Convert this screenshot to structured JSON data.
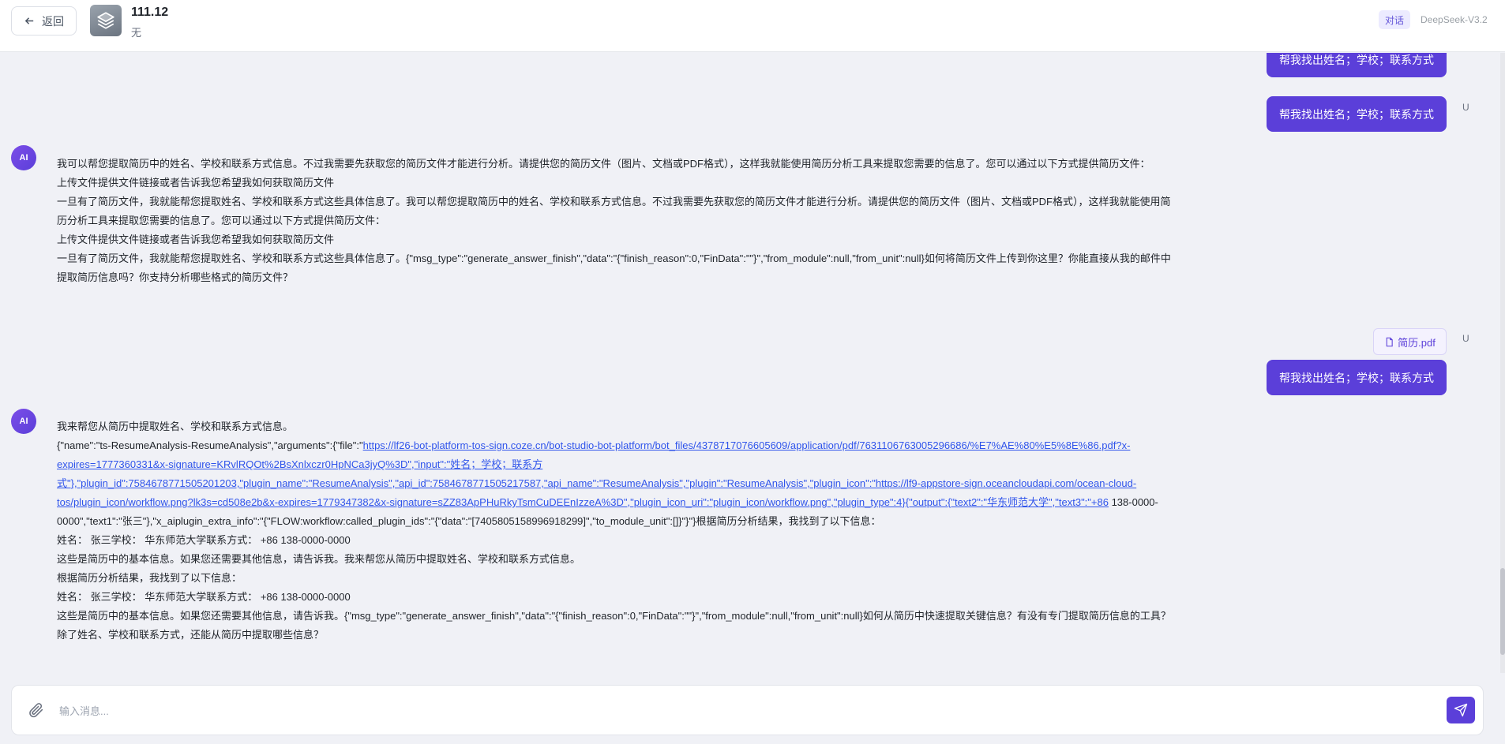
{
  "header": {
    "back_label": "返回",
    "app_title": "111.12",
    "app_subtitle": "无",
    "mode_label": "对话",
    "model_name": "DeepSeek-V3.2",
    "app_icon": "stack-layers-icon"
  },
  "messages": {
    "user_1": "帮我找出姓名；学校；联系方式",
    "user_2": "帮我找出姓名；学校；联系方式",
    "user_2_avatar": "U",
    "ai_1_avatar": "AI",
    "ai_1_lines": [
      "我可以帮您提取简历中的姓名、学校和联系方式信息。不过我需要先获取您的简历文件才能进行分析。请提供您的简历文件（图片、文档或PDF格式），这样我就能使用简历分析工具来提取您需要的信息了。您可以通过以下方式提供简历文件：",
      "上传文件提供文件链接或者告诉我您希望我如何获取简历文件",
      "一旦有了简历文件，我就能帮您提取姓名、学校和联系方式这些具体信息了。我可以帮您提取简历中的姓名、学校和联系方式信息。不过我需要先获取您的简历文件才能进行分析。请提供您的简历文件（图片、文档或PDF格式），这样我就能使用简历分析工具来提取您需要的信息了。您可以通过以下方式提供简历文件：",
      "上传文件提供文件链接或者告诉我您希望我如何获取简历文件",
      "一旦有了简历文件，我就能帮您提取姓名、学校和联系方式这些具体信息了。{\"msg_type\":\"generate_answer_finish\",\"data\":\"{\"finish_reason\":0,\"FinData\":\"\"}\",\"from_module\":null,\"from_unit\":null}如何将简历文件上传到你这里？你能直接从我的邮件中提取简历信息吗？你支持分析哪些格式的简历文件？"
    ],
    "file_name": "简历.pdf",
    "user_3_avatar": "U",
    "user_3": "帮我找出姓名；学校；联系方式",
    "ai_2_avatar": "AI",
    "ai_2_intro": "我来帮您从简历中提取姓名、学校和联系方式信息。",
    "ai_2_json_prefix": "{\"name\":\"ts-ResumeAnalysis-ResumeAnalysis\",\"arguments\":{\"file\":\"",
    "ai_2_link": "https://lf26-bot-platform-tos-sign.coze.cn/bot-studio-bot-platform/bot_files/4378717076605609/application/pdf/7631106763005296686/%E7%AE%80%E5%8E%86.pdf?x-expires=1777360331&x-signature=KRvlRQOt%2BsXnlxczr0HpNCa3jyQ%3D\",\"input\":\"姓名；学校；联系方式\"},\"plugin_id\":7584678771505201203,\"plugin_name\":\"ResumeAnalysis\",\"api_id\":7584678771505217587,\"api_name\":\"ResumeAnalysis\",\"plugin\":\"ResumeAnalysis\",\"plugin_icon\":\"https://lf9-appstore-sign.oceancloudapi.com/ocean-cloud-tos/plugin_icon/workflow.png?lk3s=cd508e2b&x-expires=1779347382&x-signature=sZZ83ApPHuRkyTsmCuDEEnIzzeA%3D\",\"plugin_icon_uri\":\"plugin_icon/workflow.png\",\"plugin_type\":4}{\"output\":{\"text2\":\"华东师范大学\",\"text3\":\"+86",
    "ai_2_json_suffix": " 138-0000-0000\",\"text1\":\"张三\"},\"x_aiplugin_extra_info\":\"{\"FLOW:workflow:called_plugin_ids\":\"{\"data\":\"[7405805158996918299]\",\"to_module_unit\":[]}\"}\"}根据简历分析结果，我找到了以下信息：",
    "ai_2_lines": [
      "姓名： 张三学校： 华东师范大学联系方式： +86 138-0000-0000",
      "这些是简历中的基本信息。如果您还需要其他信息，请告诉我。我来帮您从简历中提取姓名、学校和联系方式信息。",
      "根据简历分析结果，我找到了以下信息：",
      "姓名： 张三学校： 华东师范大学联系方式： +86 138-0000-0000",
      "这些是简历中的基本信息。如果您还需要其他信息，请告诉我。{\"msg_type\":\"generate_answer_finish\",\"data\":\"{\"finish_reason\":0,\"FinData\":\"\"}\",\"from_module\":null,\"from_unit\":null}如何从简历中快速提取关键信息？有没有专门提取简历信息的工具？除了姓名、学校和联系方式，还能从简历中提取哪些信息？"
    ]
  },
  "input": {
    "placeholder": "输入消息..."
  },
  "colors": {
    "accent": "#5b3fd9",
    "background": "#f0f1f6",
    "link": "#2f54eb"
  }
}
